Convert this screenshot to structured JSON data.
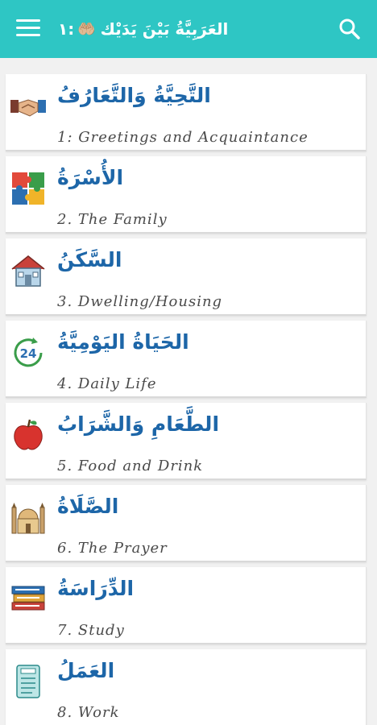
{
  "header": {
    "title_arabic": "العَرَبِيَّةُ بَيْنَ يَدَيْك",
    "title_number": "١:",
    "title_emoji": "🤲🏼",
    "menu_icon": "hamburger-menu-icon",
    "search_icon": "search-icon",
    "bar_color": "#2ec6c4"
  },
  "lessons": [
    {
      "arabic": "التَّحِيَّةُ وَالتَّعَارُفُ",
      "english": "1: Greetings and Acquaintance",
      "icon": "handshake-icon"
    },
    {
      "arabic": "الأُسْرَةُ",
      "english": "2. The Family",
      "icon": "puzzle-icon"
    },
    {
      "arabic": "السَّكَنُ",
      "english": "3. Dwelling/Housing",
      "icon": "house-icon"
    },
    {
      "arabic": "الحَيَاةُ اليَوْمِيَّةُ",
      "english": "4. Daily Life",
      "icon": "24-hours-icon"
    },
    {
      "arabic": "الطَّعَامِ وَالشَّرَابُ",
      "english": "5. Food and Drink",
      "icon": "apple-icon"
    },
    {
      "arabic": "الصَّلَاةُ",
      "english": "6. The Prayer",
      "icon": "mosque-icon"
    },
    {
      "arabic": "الدِّرَاسَةُ",
      "english": "7. Study",
      "icon": "books-icon"
    },
    {
      "arabic": "العَمَلُ",
      "english": "8. Work",
      "icon": "jobs-clipboard-icon"
    }
  ]
}
